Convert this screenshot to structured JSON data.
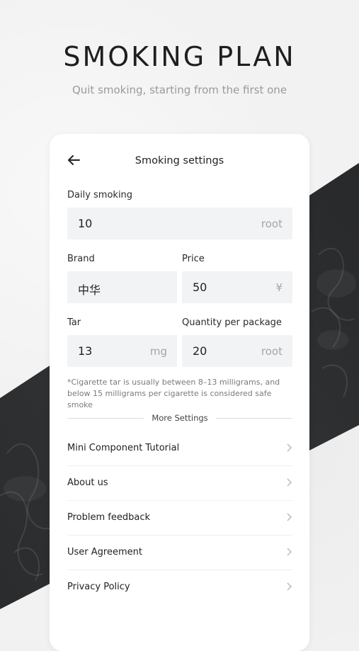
{
  "hero": {
    "title": "SMOKING PLAN",
    "subtitle": "Quit smoking, starting from the first one"
  },
  "settings": {
    "title": "Smoking settings",
    "back_icon": "back-arrow-icon",
    "fields": {
      "daily_smoking": {
        "label": "Daily smoking",
        "value": "10",
        "unit": "root"
      },
      "brand": {
        "label": "Brand",
        "value": "中华"
      },
      "price": {
        "label": "Price",
        "value": "50",
        "unit": "¥"
      },
      "tar": {
        "label": "Tar",
        "value": "13",
        "unit": "mg"
      },
      "quantity": {
        "label": "Quantity per package",
        "value": "20",
        "unit": "root"
      }
    },
    "note": "*Cigarette tar is usually between 8–13 milligrams, and below 15 milligrams per cigarette is considered safe smoke",
    "more_settings_label": "More Settings",
    "menu": [
      {
        "label": "Mini Component Tutorial"
      },
      {
        "label": "About us"
      },
      {
        "label": "Problem feedback"
      },
      {
        "label": "User Agreement"
      },
      {
        "label": "Privacy Policy"
      }
    ]
  },
  "colors": {
    "band": "#2b2d2f",
    "card": "#ffffff",
    "input_bg": "#f2f3f5",
    "unit_text": "#a5a5a5"
  }
}
